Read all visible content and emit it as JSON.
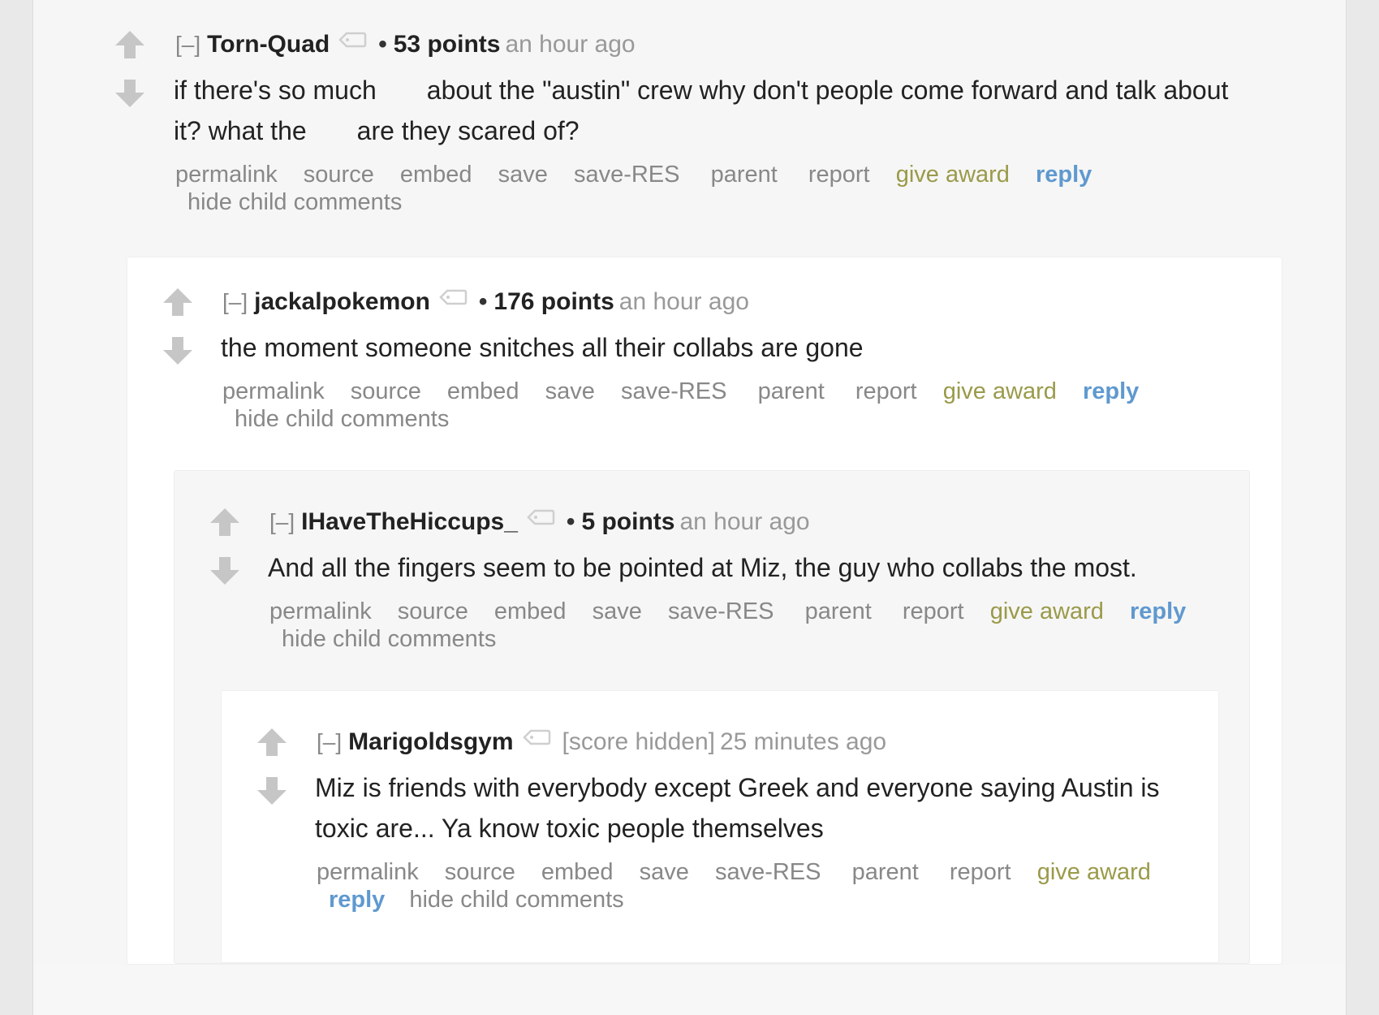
{
  "thread": {
    "comments": [
      {
        "collapse_label": "[–]",
        "author": "Torn-Quad",
        "score": "53 points",
        "time": "an hour ago",
        "body_parts": [
          "if there's so much",
          "about the \"austin\" crew why don't people come forward and talk about it? what the",
          "are they scared of?"
        ]
      },
      {
        "collapse_label": "[–]",
        "author": "jackalpokemon",
        "score": "176 points",
        "time": "an hour ago",
        "body": "the moment someone snitches all their collabs are gone"
      },
      {
        "collapse_label": "[–]",
        "author": "IHaveTheHiccups_",
        "score": "5 points",
        "time": "an hour ago",
        "body": "And all the fingers seem to be pointed at Miz, the guy who collabs the most."
      },
      {
        "collapse_label": "[–]",
        "author": "Marigoldsgym",
        "score_hidden": "[score hidden]",
        "time": "25 minutes ago",
        "body": "Miz is friends with everybody except Greek and everyone saying Austin is toxic are... Ya know toxic people themselves"
      }
    ]
  },
  "buttons": {
    "permalink": "permalink",
    "source": "source",
    "embed": "embed",
    "save": "save",
    "save_res": "save-RES",
    "parent": "parent",
    "report": "report",
    "give_award": "give award",
    "reply": "reply",
    "hide_child": "hide child comments"
  },
  "separator": "•",
  "colors": {
    "award": "#9a9a4a",
    "reply": "#5f99cf",
    "muted": "#888888",
    "text": "#222222"
  },
  "icons": {
    "upvote": "upvote-arrow-icon",
    "downvote": "downvote-arrow-icon",
    "flair": "tag-icon"
  }
}
